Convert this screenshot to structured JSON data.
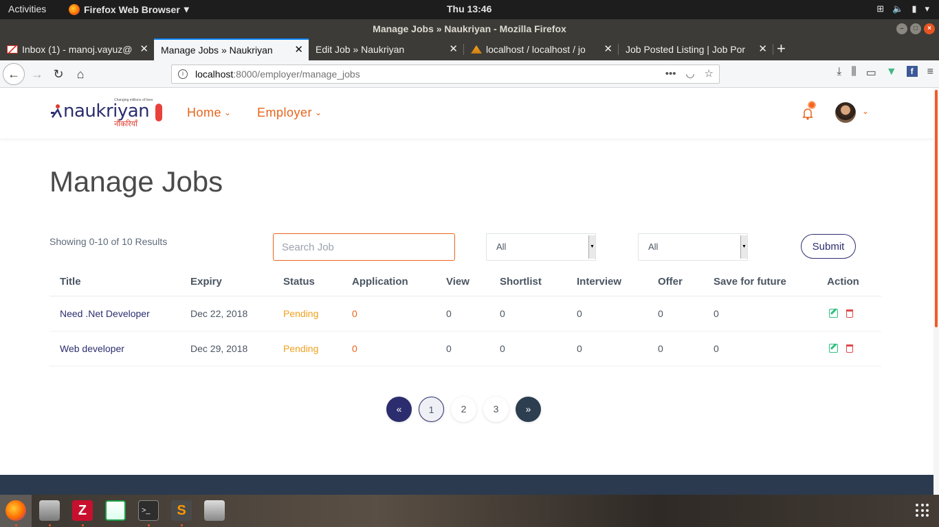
{
  "system": {
    "activities": "Activities",
    "app_name": "Firefox Web Browser",
    "clock": "Thu 13:46"
  },
  "window": {
    "title": "Manage Jobs » Naukriyan - Mozilla Firefox"
  },
  "tabs": [
    {
      "label": "Inbox (1) - manoj.vayuz@",
      "icon": "gmail-icon"
    },
    {
      "label": "Manage Jobs » Naukriyan",
      "icon": "none"
    },
    {
      "label": "Edit Job » Naukriyan",
      "icon": "none"
    },
    {
      "label": "localhost / localhost / jo",
      "icon": "phpmyadmin-icon"
    },
    {
      "label": "Job Posted Listing | Job Por",
      "icon": "none"
    }
  ],
  "urlbar": {
    "host": "localhost",
    "path": ":8000/employer/manage_jobs"
  },
  "site": {
    "logo_text": "naukriyan",
    "logo_tagline": "Changing millions of lives",
    "logo_hindi": "नौकरियाँ",
    "menu": [
      {
        "label": "Home"
      },
      {
        "label": "Employer"
      }
    ]
  },
  "main": {
    "title": "Manage Jobs",
    "results_text": "Showing 0-10 of 10 Results",
    "search_placeholder": "Search Job",
    "filter1": "All",
    "filter2": "All",
    "submit_label": "Submit",
    "columns": [
      "Title",
      "Expiry",
      "Status",
      "Application",
      "View",
      "Shortlist",
      "Interview",
      "Offer",
      "Save for future",
      "Action"
    ],
    "rows": [
      {
        "title": "Need .Net Developer",
        "expiry": "Dec 22, 2018",
        "status": "Pending",
        "application": "0",
        "view": "0",
        "shortlist": "0",
        "interview": "0",
        "offer": "0",
        "save": "0"
      },
      {
        "title": "Web developer",
        "expiry": "Dec 29, 2018",
        "status": "Pending",
        "application": "0",
        "view": "0",
        "shortlist": "0",
        "interview": "0",
        "offer": "0",
        "save": "0"
      }
    ],
    "pagination": {
      "prev": "«",
      "pages": [
        "1",
        "2",
        "3"
      ],
      "next": "»",
      "current": "1"
    }
  },
  "colors": {
    "brand_orange": "#e8641b",
    "brand_navy": "#2b2d6e",
    "status_pending": "#f0a01e",
    "edit_green": "#2dbf7f",
    "delete_red": "#e04848"
  }
}
